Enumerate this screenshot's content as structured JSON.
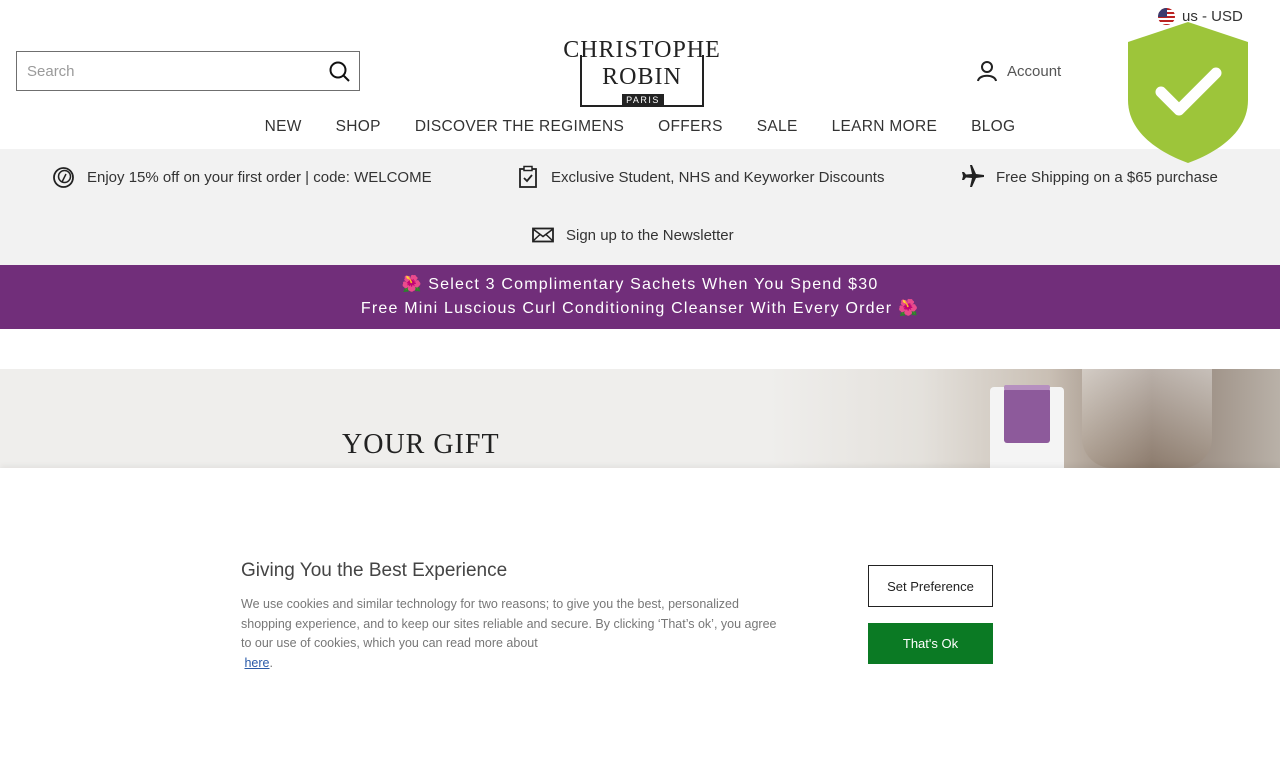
{
  "locale": {
    "label": "us - USD"
  },
  "search": {
    "placeholder": "Search"
  },
  "brand": {
    "line1": "CHRISTOPHE",
    "line2": "ROBIN",
    "line3": "PARIS"
  },
  "account": {
    "label": "Account"
  },
  "nav": {
    "items": [
      {
        "label": "NEW"
      },
      {
        "label": "SHOP"
      },
      {
        "label": "DISCOVER THE REGIMENS"
      },
      {
        "label": "OFFERS"
      },
      {
        "label": "SALE"
      },
      {
        "label": "LEARN MORE"
      },
      {
        "label": "BLOG"
      }
    ]
  },
  "benefits": [
    {
      "label": "Enjoy 15% off on your first order | code: WELCOME",
      "icon": "discount-icon"
    },
    {
      "label": "Exclusive Student, NHS and Keyworker Discounts",
      "icon": "clipboard-check-icon"
    },
    {
      "label": "Free Shipping on a $65 purchase",
      "icon": "plane-icon"
    },
    {
      "label": "Sign up to the Newsletter",
      "icon": "envelope-icon"
    }
  ],
  "promo": {
    "line1": "🌺 Select 3 Complimentary Sachets When You Spend $30",
    "line2": "Free Mini Luscious Curl Conditioning Cleanser With Every Order 🌺",
    "color": "#712e7a"
  },
  "hero": {
    "title": "YOUR GIFT"
  },
  "cookie": {
    "title": "Giving You the Best Experience",
    "body": "We use cookies and similar technology for two reasons; to give you the best, personalized shopping experience, and to keep our sites reliable and secure. By clicking ‘That’s ok’, you agree to our use of cookies, which you can read more about",
    "link": "here",
    "link_suffix": ".",
    "set_preference": "Set Preference",
    "accept": "That's Ok",
    "accept_color": "#0b7a24"
  },
  "badge": {
    "icon": "shield-check-icon",
    "color": "#9dc53a"
  }
}
